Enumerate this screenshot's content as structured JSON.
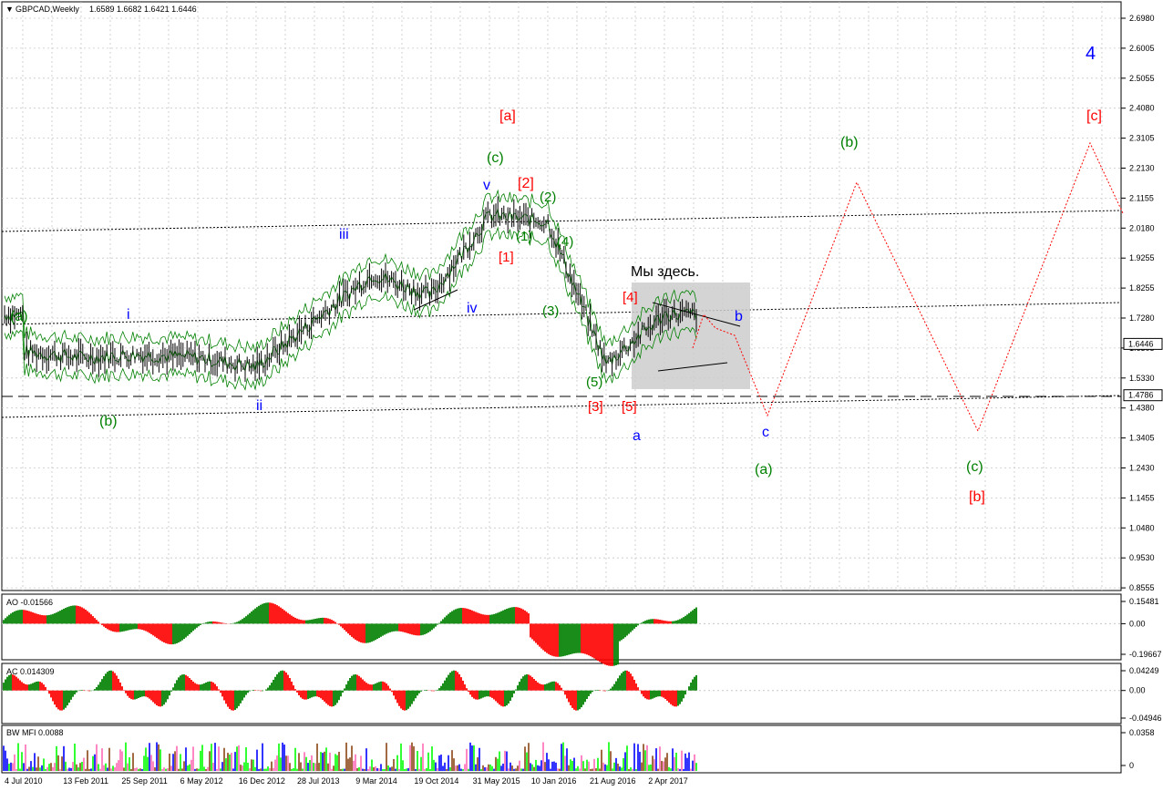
{
  "header": {
    "symbol": "GBPCAD,Weekly",
    "ohlc": "1.6589 1.6682 1.6421 1.6446"
  },
  "colors": {
    "green": "#008000",
    "red": "#ff0000",
    "blue": "#0000ff",
    "dark_red": "#cc0000",
    "grid": "#c8c8c8",
    "ma": "#008000",
    "bar": "#000000",
    "projection": "#ff0000",
    "zone": "#cccccc",
    "mfi_green": "#00ff00",
    "mfi_blue": "#0000ff",
    "mfi_brown": "#8b4513",
    "mfi_pink": "#ff69b4"
  },
  "price_axis": {
    "ticks": [
      "2.6980",
      "2.6005",
      "2.5055",
      "2.4080",
      "2.3105",
      "2.2130",
      "2.1155",
      "2.0180",
      "1.9255",
      "1.8255",
      "1.7280",
      "1.6305",
      "1.5330",
      "1.4380",
      "1.3405",
      "1.2430",
      "1.1455",
      "1.0480",
      "0.9530",
      "0.8555"
    ],
    "current_price": "1.6446",
    "level_price": "1.4786"
  },
  "time_axis": {
    "labels": [
      "4 Jul 2010",
      "13 Feb 2011",
      "25 Sep 2011",
      "6 May 2012",
      "16 Dec 2012",
      "28 Jul 2013",
      "9 Mar 2014",
      "19 Oct 2014",
      "31 May 2015",
      "10 Jan 2016",
      "21 Aug 2016",
      "2 Apr 2017"
    ]
  },
  "annotation_text": "Мы здесь.",
  "wave_labels": {
    "a_green": "(a)",
    "b_green_low": "(b)",
    "i": "i",
    "ii": "ii",
    "iii": "iii",
    "iv": "iv",
    "v": "v",
    "c_green_top": "(c)",
    "a_red": "[a]",
    "two_red": "[2]",
    "two_green": "(2)",
    "one_green": "(1)",
    "one_red": "[1]",
    "four_green": "(4)",
    "three_green": "(3)",
    "five_green": "(5)",
    "four_red": "[4]",
    "three_red": "[3]",
    "five_red": "[5]",
    "a_blue": "a",
    "b_blue": "b",
    "c_blue": "c",
    "a_green_future": "(a)",
    "b_green_future": "(b)",
    "c_green_future": "(c)",
    "b_red_future": "[b]",
    "c_red_future": "[c]",
    "four_blue": "4"
  },
  "panels": {
    "ao": {
      "label": "AO -0.01566",
      "ticks": [
        "0.15481",
        "0.00",
        "-0.19667"
      ]
    },
    "ac": {
      "label": "AC 0.014309",
      "ticks": [
        "0.04249",
        "0.00",
        "-0.04946"
      ]
    },
    "mfi": {
      "label": "BW MFI 0.0088",
      "ticks": [
        "0.0358",
        "0"
      ]
    }
  },
  "chart_data": {
    "type": "line",
    "title": "GBPCAD,Weekly",
    "ohlc_last": {
      "open": 1.6589,
      "high": 1.6682,
      "low": 1.6421,
      "close": 1.6446
    },
    "series": [
      {
        "name": "GBPCAD,Weekly",
        "x": [
          "4 Jul 2010",
          "13 Feb 2011",
          "25 Sep 2011",
          "6 May 2012",
          "16 Dec 2012",
          "28 Jul 2013",
          "9 Mar 2014",
          "19 Oct 2014",
          "31 May 2015",
          "10 Jan 2016",
          "21 Aug 2016",
          "2 Apr 2017"
        ],
        "y": [
          1.62,
          1.6,
          1.61,
          1.6,
          1.57,
          1.72,
          1.87,
          1.8,
          2.06,
          2.04,
          1.58,
          1.74
        ]
      }
    ],
    "projection": [
      "2017-c 1.42",
      "2019-b 2.17",
      "2021-c 1.37",
      "2022-c 2.28"
    ],
    "ylim": [
      0.8555,
      2.698
    ]
  }
}
